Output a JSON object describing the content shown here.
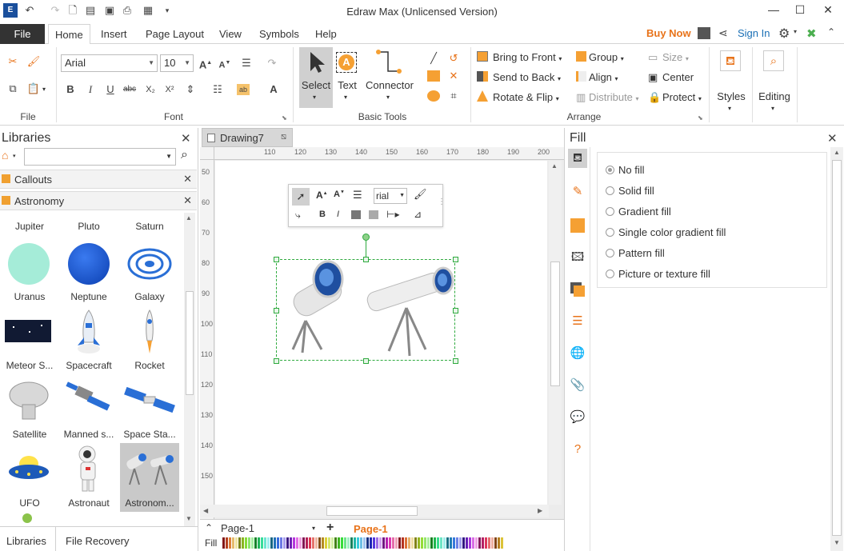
{
  "window": {
    "title": "Edraw Max (Unlicensed Version)",
    "buy_now": "Buy Now",
    "sign_in": "Sign In"
  },
  "menu": {
    "file": "File",
    "tabs": [
      "Home",
      "Insert",
      "Page Layout",
      "View",
      "Symbols",
      "Help"
    ]
  },
  "ribbon": {
    "font_name": "Arial",
    "font_size": "10",
    "groups": {
      "file": "File",
      "font": "Font",
      "basic_tools": "Basic Tools",
      "arrange": "Arrange"
    },
    "tools": {
      "select": "Select",
      "text": "Text",
      "connector": "Connector"
    },
    "arrange": {
      "bring_to_front": "Bring to Front",
      "send_to_back": "Send to Back",
      "rotate_flip": "Rotate & Flip",
      "group": "Group",
      "align": "Align",
      "distribute": "Distribute",
      "size": "Size",
      "center": "Center",
      "protect": "Protect"
    },
    "styles": "Styles",
    "editing": "Editing"
  },
  "libraries": {
    "title": "Libraries",
    "categories": [
      "Callouts",
      "Astronomy"
    ],
    "top_row": [
      "Jupiter",
      "Pluto",
      "Saturn"
    ],
    "shapes": [
      {
        "label": "Uranus",
        "icon": "uranus-icon"
      },
      {
        "label": "Neptune",
        "icon": "neptune-icon"
      },
      {
        "label": "Galaxy",
        "icon": "galaxy-icon"
      },
      {
        "label": "Meteor S...",
        "icon": "meteor-icon"
      },
      {
        "label": "Spacecraft",
        "icon": "spacecraft-icon"
      },
      {
        "label": "Rocket",
        "icon": "rocket-icon"
      },
      {
        "label": "Satellite",
        "icon": "satellite-dish-icon"
      },
      {
        "label": "Manned s...",
        "icon": "manned-satellite-icon"
      },
      {
        "label": "Space Sta...",
        "icon": "space-station-icon"
      },
      {
        "label": "UFO",
        "icon": "ufo-icon"
      },
      {
        "label": "Astronaut",
        "icon": "astronaut-icon"
      },
      {
        "label": "Astronom...",
        "icon": "telescope-icon"
      }
    ],
    "bottom_tabs": [
      "Libraries",
      "File Recovery"
    ]
  },
  "document": {
    "tab_name": "Drawing7",
    "hruler": [
      "110",
      "120",
      "130",
      "140",
      "150",
      "160",
      "170",
      "180",
      "190",
      "200"
    ],
    "vruler": [
      "50",
      "60",
      "70",
      "80",
      "90",
      "100",
      "110",
      "120",
      "130",
      "140",
      "150"
    ],
    "mini_font": "rial"
  },
  "pages": {
    "current": "Page-1",
    "tab": "Page-1"
  },
  "fill": {
    "title": "Fill",
    "options": [
      "No fill",
      "Solid fill",
      "Gradient fill",
      "Single color gradient fill",
      "Pattern fill",
      "Picture or texture fill"
    ],
    "selected": 0,
    "bar_label": "Fill"
  },
  "colors": {
    "accent_orange": "#e8731a",
    "link_blue": "#1a6fb5",
    "file_tab": "#333333"
  }
}
